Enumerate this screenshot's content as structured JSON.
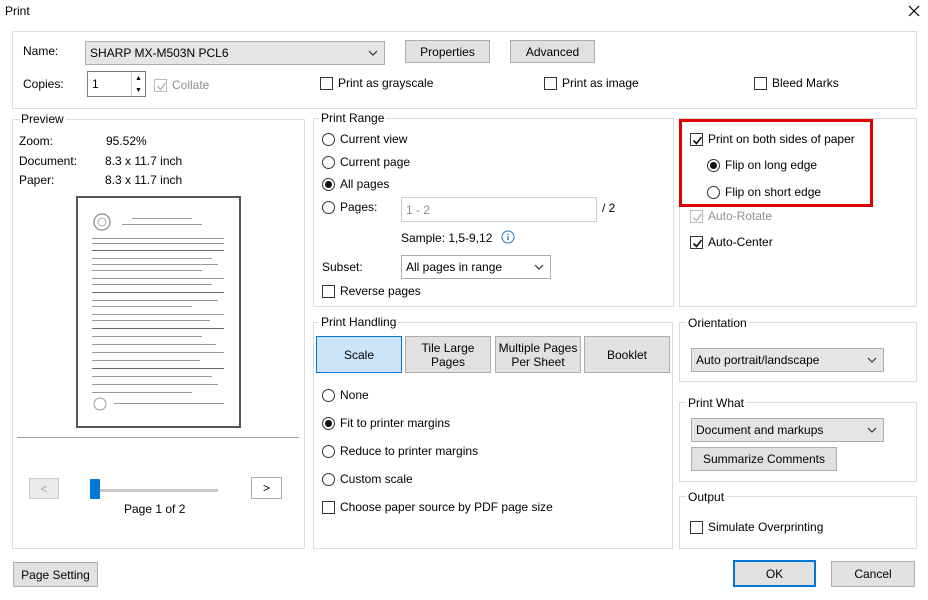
{
  "window": {
    "title": "Print"
  },
  "printer": {
    "name_label": "Name:",
    "name_value": "SHARP MX-M503N PCL6",
    "properties_label": "Properties",
    "advanced_label": "Advanced",
    "copies_label": "Copies:",
    "copies_value": "1",
    "collate_label": "Collate",
    "grayscale_label": "Print as grayscale",
    "as_image_label": "Print as image",
    "bleed_label": "Bleed Marks"
  },
  "preview": {
    "legend": "Preview",
    "zoom_label": "Zoom:",
    "zoom_value": "95.52%",
    "document_label": "Document:",
    "document_value": "8.3 x 11.7 inch",
    "paper_label": "Paper:",
    "paper_value": "8.3 x 11.7 inch",
    "prev_label": "<",
    "next_label": ">",
    "page_indicator": "Page 1 of 2",
    "slider_position": 0
  },
  "print_range": {
    "legend": "Print Range",
    "current_view": "Current view",
    "current_page": "Current page",
    "all_pages": "All pages",
    "pages_label": "Pages:",
    "pages_placeholder": "1 - 2",
    "pages_total": "/ 2",
    "sample": "Sample: 1,5-9,12",
    "subset_label": "Subset:",
    "subset_value": "All pages in range",
    "reverse_label": "Reverse pages"
  },
  "handling": {
    "legend": "Print Handling",
    "tabs": [
      "Scale",
      "Tile Large Pages",
      "Multiple Pages Per Sheet",
      "Booklet"
    ],
    "none": "None",
    "fit": "Fit to printer margins",
    "reduce": "Reduce to printer margins",
    "custom": "Custom scale",
    "paper_source": "Choose paper source by PDF page size"
  },
  "duplex": {
    "both_sides": "Print on both sides of paper",
    "long_edge": "Flip on long edge",
    "short_edge": "Flip on short edge",
    "auto_rotate": "Auto-Rotate",
    "auto_center": "Auto-Center"
  },
  "orientation": {
    "legend": "Orientation",
    "value": "Auto portrait/landscape"
  },
  "print_what": {
    "legend": "Print What",
    "value": "Document and markups",
    "summarize_label": "Summarize Comments"
  },
  "output": {
    "legend": "Output",
    "simulate_label": "Simulate Overprinting"
  },
  "footer": {
    "page_setting": "Page Setting",
    "ok": "OK",
    "cancel": "Cancel"
  },
  "colors": {
    "highlight": "#e00000",
    "accent": "#0078d7"
  }
}
